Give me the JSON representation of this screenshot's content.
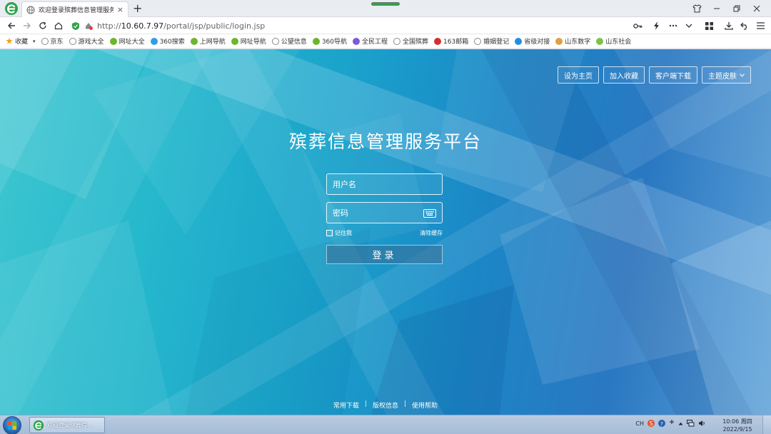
{
  "browser": {
    "tab_title": "欢迎登录殡葬信息管理服务平",
    "tab_close": "×",
    "new_tab": "+",
    "url_prefix": "http://",
    "url_host": "10.60.7.97",
    "url_path": "/portal/jsp/public/login.jsp"
  },
  "bookmarks": [
    {
      "label": "收藏",
      "icon": "star-icon",
      "color": "#f0a020"
    },
    {
      "label": "京东",
      "icon": "globe-icon",
      "color": "#8a8a8a"
    },
    {
      "label": "游戏大全",
      "icon": "globe-icon",
      "color": "#8a8a8a"
    },
    {
      "label": "网址大全",
      "icon": "ie-icon",
      "color": "#6cb52d"
    },
    {
      "label": "360搜索",
      "icon": "360-icon",
      "color": "#2f9ee8"
    },
    {
      "label": "上网导航",
      "icon": "ie-icon",
      "color": "#6cb52d"
    },
    {
      "label": "网址导航",
      "icon": "ie-icon",
      "color": "#6cb52d"
    },
    {
      "label": "公望信息",
      "icon": "globe-icon",
      "color": "#8a8a8a"
    },
    {
      "label": "360导航",
      "icon": "ie-icon",
      "color": "#6cb52d"
    },
    {
      "label": "全民工程",
      "icon": "gem-icon",
      "color": "#7b5cd6"
    },
    {
      "label": "全国殡葬",
      "icon": "globe-icon",
      "color": "#8a8a8a"
    },
    {
      "label": "163邮箱",
      "icon": "mail-icon",
      "color": "#d0312d"
    },
    {
      "label": "婚姻登记",
      "icon": "globe-icon",
      "color": "#8a8a8a"
    },
    {
      "label": "省级对接",
      "icon": "bird-icon",
      "color": "#1f8fe0"
    },
    {
      "label": "山东数字",
      "icon": "sd-icon",
      "color": "#e0a040"
    },
    {
      "label": "山东社会",
      "icon": "leaf-icon",
      "color": "#7cc24a"
    }
  ],
  "page": {
    "top_buttons": [
      "设为主页",
      "加入收藏",
      "客户端下载",
      "主题皮肤"
    ],
    "title": "殡葬信息管理服务平台",
    "username_placeholder": "用户名",
    "password_placeholder": "密码",
    "remember_label": "记住我",
    "clear_cache_label": "清除缓存",
    "login_label": "登录",
    "footer_links": [
      "常用下载",
      "版权信息",
      "使用帮助"
    ],
    "footer_sep": "|"
  },
  "taskbar": {
    "task_label": "欢迎登录殡葬信...",
    "tray_ime": "CH",
    "clock_time": "10:06 周四",
    "clock_date": "2022/9/15"
  },
  "colors": {
    "accent_green": "#2fa34a",
    "page_gradient_left": "#3ec6d0",
    "page_gradient_right": "#2a78c2"
  }
}
